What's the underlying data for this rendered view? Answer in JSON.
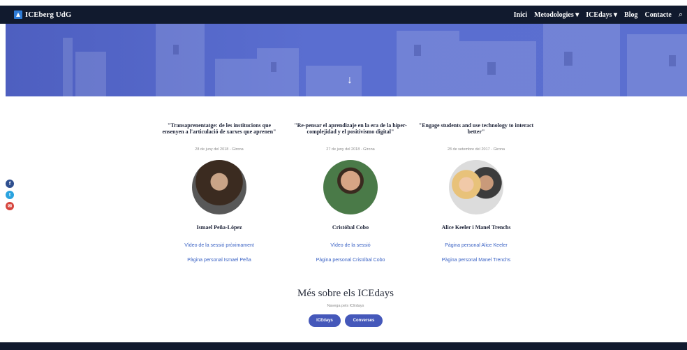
{
  "header": {
    "logo_text": "ICEberg UdG",
    "nav": [
      "Inici",
      "Metodologies ▾",
      "ICEdays ▾",
      "Blog",
      "Contacte"
    ],
    "search_glyph": "⌕"
  },
  "hero": {
    "arrow": "↓"
  },
  "social": {
    "facebook": "f",
    "twitter": "t",
    "email": "✉"
  },
  "events": [
    {
      "title": "\"Transaprenentatge: de les institucions que ensenyen a l'articulació de xarxes que aprenen\"",
      "date": "28 de juny del 2018 - Girona",
      "name": "Ismael Peña-López",
      "links": [
        "Vídeo de la sessió pròximament",
        "Pàgina personal Ismael Peña"
      ]
    },
    {
      "title": "\"Re-pensar el aprendizaje en la era de la híper-complejidad y el positivismo digital\"",
      "date": "27 de juny del 2018 - Girona",
      "name": "Cristóbal Cobo",
      "links": [
        "Vídeo de la sessió",
        "Pàgina personal Cristóbal Cobo"
      ]
    },
    {
      "title": "\"Engage students and use technology to interact better\"",
      "date": "28 de setembre del 2017 - Girona",
      "name": "Alice Keeler i Manel Trenchs",
      "links": [
        "Pàgina personal Alice Keeler",
        "Pàgina personal Manel Trenchs"
      ]
    }
  ],
  "more": {
    "title": "Més sobre els ICEdays",
    "subtitle": "Navega pels ICEdays",
    "buttons": [
      "ICEdays",
      "Converses"
    ]
  },
  "colors": {
    "navbar": "#111a2e",
    "hero": "#5a6ed0",
    "accent": "#4558ba",
    "link": "#3a62c4"
  }
}
